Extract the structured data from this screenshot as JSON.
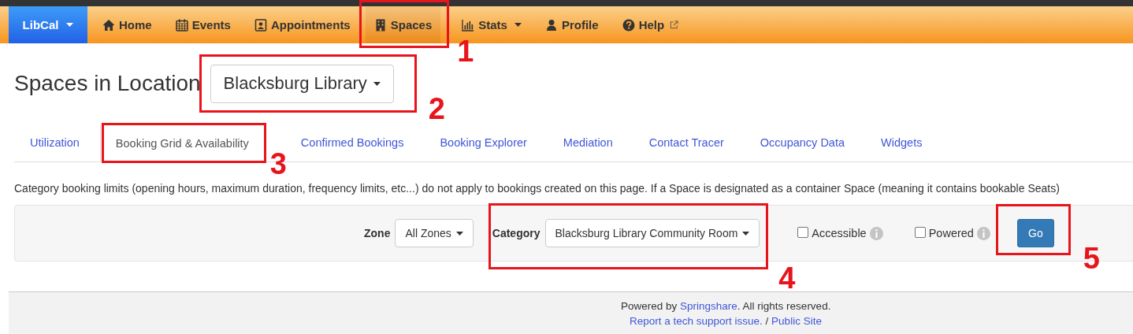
{
  "navbar": {
    "brand": "LibCal",
    "items": [
      {
        "label": "Home",
        "kind": "plain",
        "selected": false
      },
      {
        "label": "Events",
        "kind": "plain",
        "selected": false
      },
      {
        "label": "Appointments",
        "kind": "plain",
        "selected": false
      },
      {
        "label": "Spaces",
        "kind": "plain",
        "selected": true,
        "callout": "1"
      },
      {
        "label": "Stats",
        "kind": "dropdown",
        "selected": false
      },
      {
        "label": "Profile",
        "kind": "plain",
        "selected": false
      },
      {
        "label": "Help",
        "kind": "external",
        "selected": false
      }
    ]
  },
  "heading": {
    "title": "Spaces in Location",
    "location": "Blacksburg Library",
    "callout": "2"
  },
  "tabs": [
    {
      "label": "Utilization",
      "selected": false
    },
    {
      "label": "Booking Grid & Availability",
      "selected": true,
      "callout": "3"
    },
    {
      "label": "Confirmed Bookings",
      "selected": false
    },
    {
      "label": "Booking Explorer",
      "selected": false
    },
    {
      "label": "Mediation",
      "selected": false
    },
    {
      "label": "Contact Tracer",
      "selected": false
    },
    {
      "label": "Occupancy Data",
      "selected": false
    },
    {
      "label": "Widgets",
      "selected": false
    }
  ],
  "notice": "Category booking limits (opening hours, maximum duration, frequency limits, etc...) do not apply to bookings created on this page. If a Space is designated as a container Space (meaning it contains bookable Seats)",
  "filters": {
    "zone": {
      "label": "Zone",
      "value": "All Zones"
    },
    "category": {
      "label": "Category",
      "value": "Blacksburg Library Community Room",
      "callout": "4"
    },
    "checkboxes": [
      {
        "label": "Accessible",
        "checked": false
      },
      {
        "label": "Powered",
        "checked": false
      }
    ],
    "go": {
      "label": "Go",
      "callout": "5"
    }
  },
  "footer": {
    "line1": [
      "Powered by ",
      "Springshare",
      ". All rights reserved."
    ],
    "line2": [
      "Report a tech support issue.",
      " / ",
      "Public Site"
    ]
  }
}
